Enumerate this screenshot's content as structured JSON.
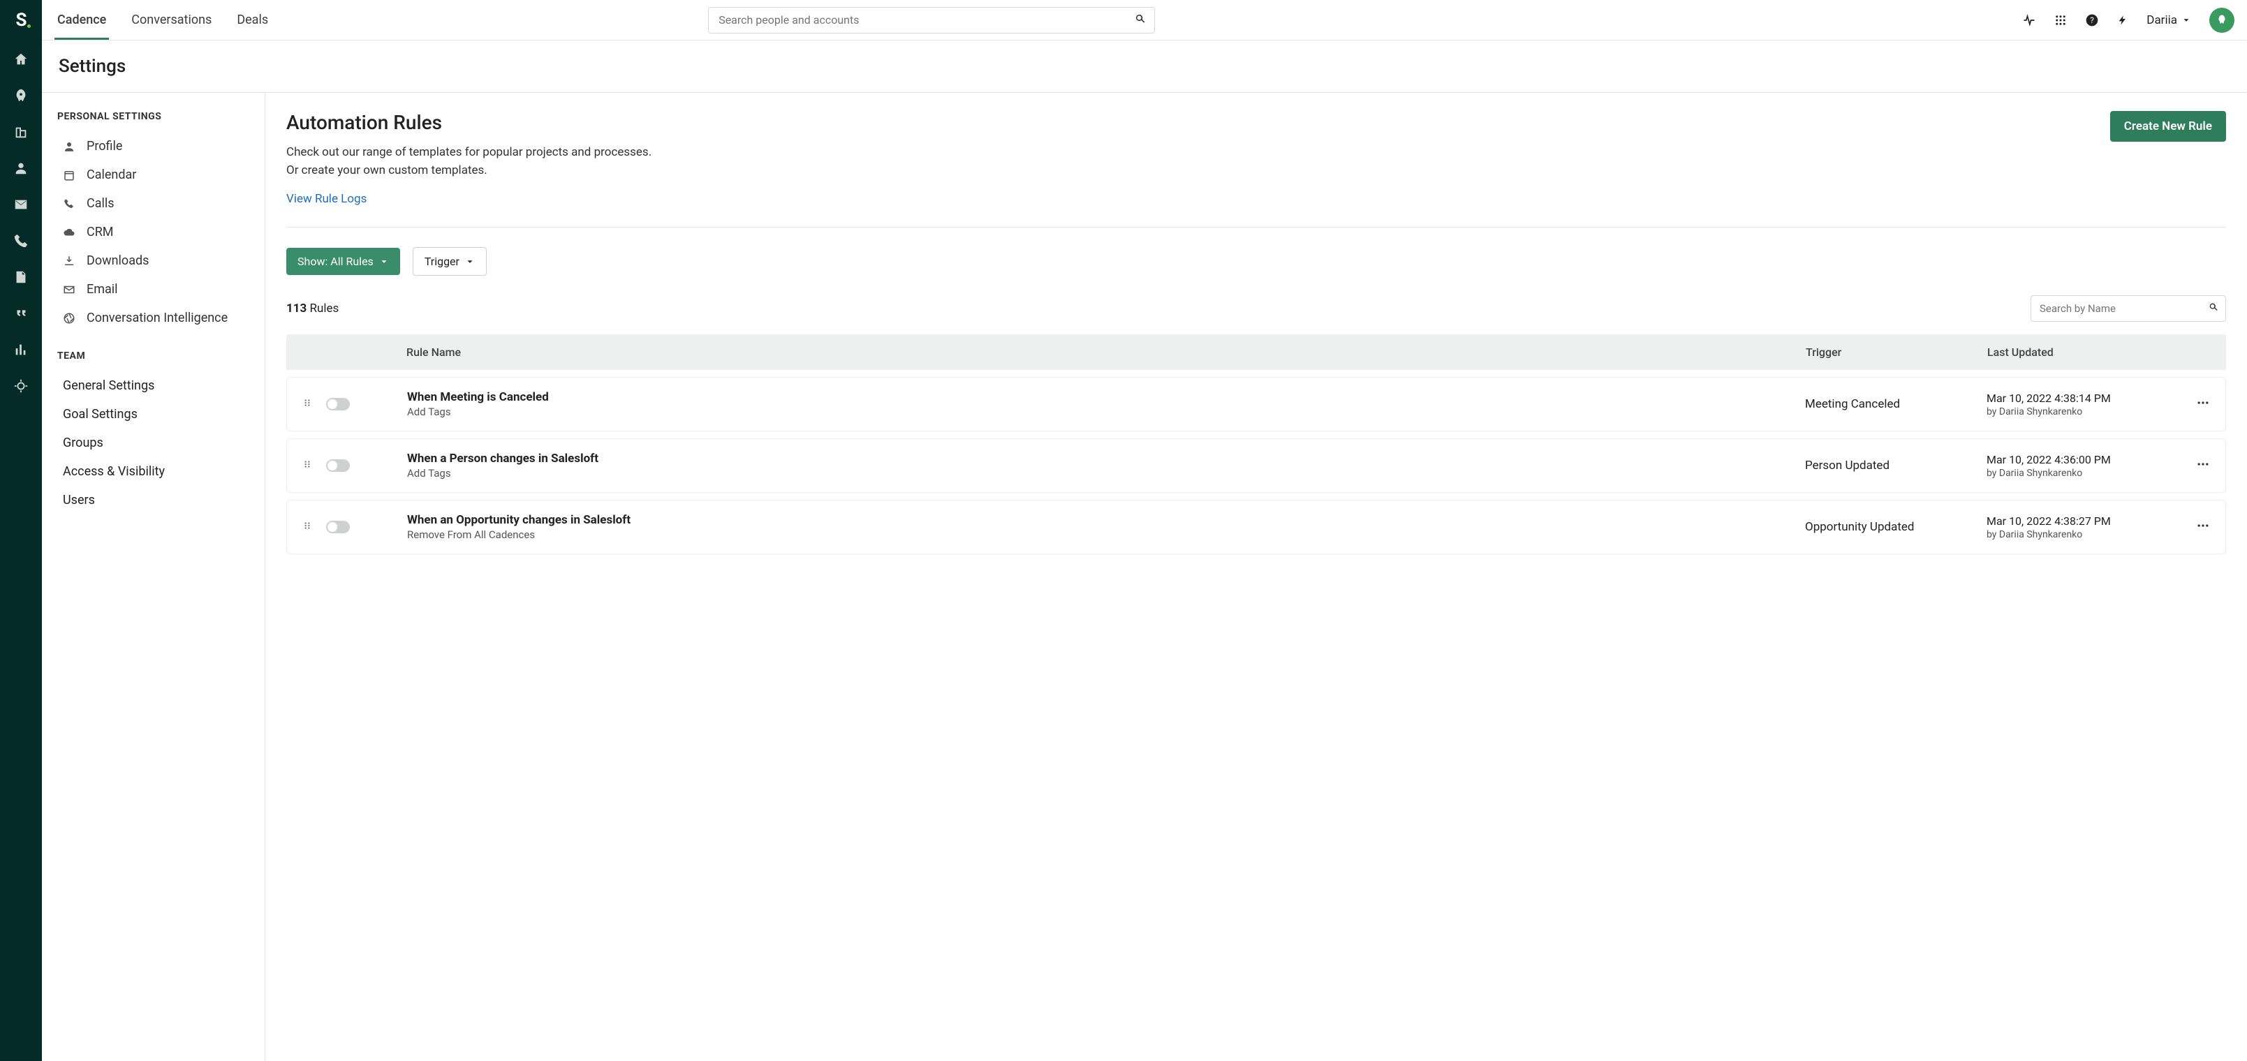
{
  "topnav": {
    "items": [
      {
        "label": "Cadence",
        "active": true
      },
      {
        "label": "Conversations"
      },
      {
        "label": "Deals"
      }
    ]
  },
  "search": {
    "placeholder": "Search people and accounts"
  },
  "user": {
    "name": "Dariia"
  },
  "page": {
    "title": "Settings"
  },
  "sidebar": {
    "personal_label": "PERSONAL SETTINGS",
    "personal": [
      {
        "label": "Profile"
      },
      {
        "label": "Calendar"
      },
      {
        "label": "Calls"
      },
      {
        "label": "CRM"
      },
      {
        "label": "Downloads"
      },
      {
        "label": "Email"
      },
      {
        "label": "Conversation Intelligence"
      }
    ],
    "team_label": "TEAM",
    "team": [
      {
        "label": "General Settings"
      },
      {
        "label": "Goal Settings"
      },
      {
        "label": "Groups"
      },
      {
        "label": "Access & Visibility"
      },
      {
        "label": "Users"
      }
    ]
  },
  "content": {
    "heading": "Automation Rules",
    "sub1": "Check out our range of templates for popular projects and processes.",
    "sub2": "Or create your own custom templates.",
    "view_logs": "View Rule Logs",
    "create_btn": "Create New Rule",
    "show_label": "Show: All Rules",
    "trigger_label": "Trigger",
    "count_number": "113",
    "count_word": "Rules",
    "mini_search_placeholder": "Search by Name",
    "cols": {
      "name": "Rule Name",
      "trigger": "Trigger",
      "updated": "Last Updated"
    },
    "rules": [
      {
        "name": "When Meeting is Canceled",
        "sub": "Add Tags",
        "trigger": "Meeting Canceled",
        "updated": "Mar 10, 2022 4:38:14 PM",
        "by": "by Dariia Shynkarenko"
      },
      {
        "name": "When a Person changes in Salesloft",
        "sub": "Add Tags",
        "trigger": "Person Updated",
        "updated": "Mar 10, 2022 4:36:00 PM",
        "by": "by Dariia Shynkarenko"
      },
      {
        "name": "When an Opportunity changes in Salesloft",
        "sub": "Remove From All Cadences",
        "trigger": "Opportunity Updated",
        "updated": "Mar 10, 2022 4:38:27 PM",
        "by": "by Dariia Shynkarenko"
      }
    ]
  }
}
